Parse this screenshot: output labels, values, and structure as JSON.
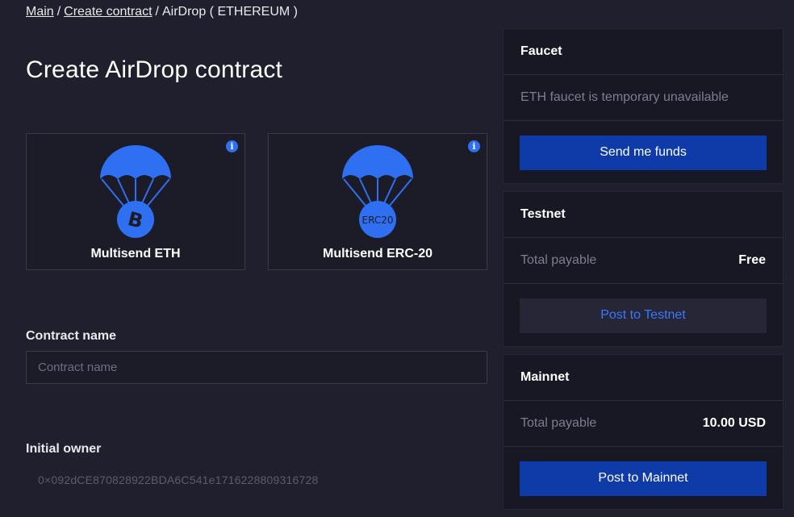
{
  "breadcrumb": {
    "items": [
      "Main",
      "Create contract"
    ],
    "current": "AirDrop ( ETHEREUM )",
    "separator": "/"
  },
  "page": {
    "title": "Create AirDrop contract"
  },
  "contract_types": [
    {
      "label": "Multisend ETH",
      "badge": "B",
      "icon": "parachute-bitcoin-icon"
    },
    {
      "label": "Multisend ERC-20",
      "badge": "ERC20",
      "icon": "parachute-erc20-icon"
    }
  ],
  "form": {
    "contract_name": {
      "label": "Contract name",
      "placeholder": "Contract name",
      "value": ""
    },
    "initial_owner": {
      "label": "Initial owner",
      "value": "0×092dCE870828922BDA6C541e1716228809316728"
    }
  },
  "faucet": {
    "title": "Faucet",
    "message": "ETH faucet is temporary unavailable",
    "button": "Send me funds"
  },
  "testnet": {
    "title": "Testnet",
    "payable_label": "Total payable",
    "payable_value": "Free",
    "button": "Post to Testnet"
  },
  "mainnet": {
    "title": "Mainnet",
    "payable_label": "Total payable",
    "payable_value": "10.00 USD",
    "button": "Post to Mainnet"
  },
  "colors": {
    "background": "#1f1f2d",
    "accent": "#2f6ff2",
    "primary_button": "#0f3ba8",
    "secondary_button_text": "#3a77ff"
  }
}
